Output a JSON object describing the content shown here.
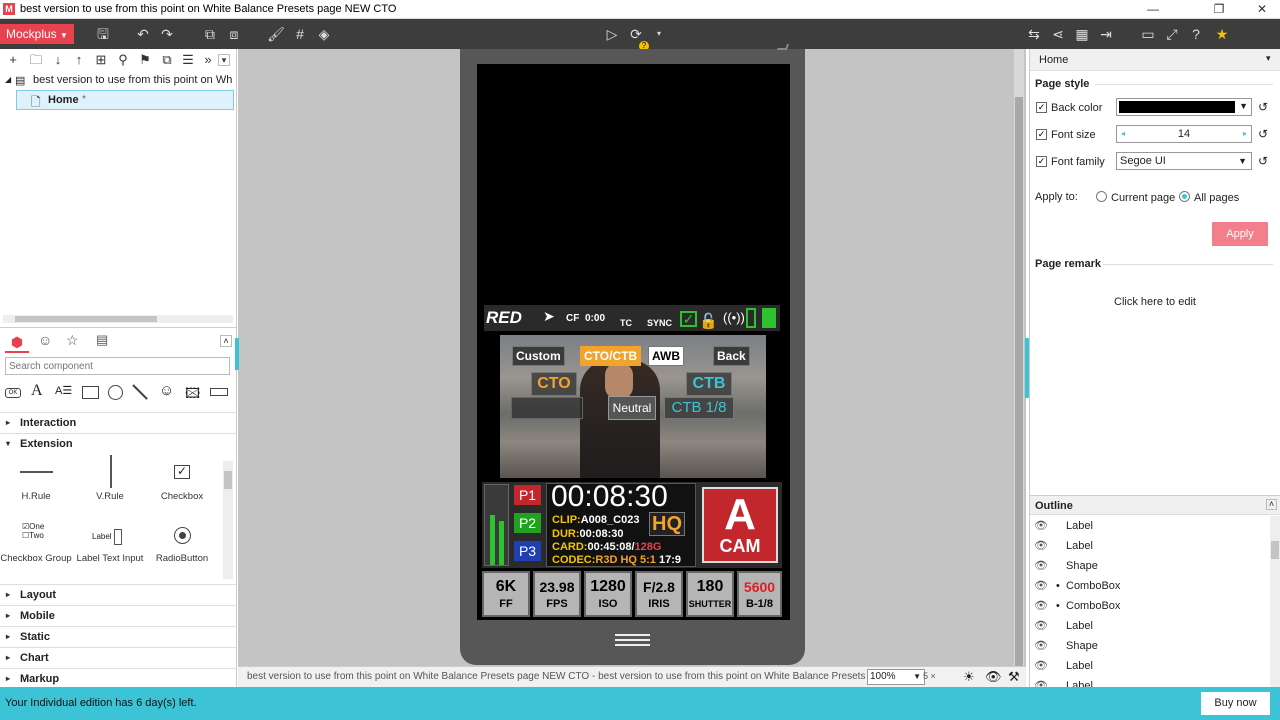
{
  "window": {
    "title": "best version to use from this point on White Balance Presets page NEW CTO"
  },
  "toolbar": {
    "brand": "Mockplus"
  },
  "tree": {
    "project": "best version to use from this point on White B",
    "page": "Home",
    "page_marker": "*"
  },
  "library": {
    "search_placeholder": "Search component",
    "categories": [
      "Interaction",
      "Extension",
      "Layout",
      "Mobile",
      "Static",
      "Chart",
      "Markup"
    ],
    "components": [
      {
        "label": "H.Rule"
      },
      {
        "label": "V.Rule"
      },
      {
        "label": "Checkbox"
      },
      {
        "label": "Checkbox Group",
        "opt1": "One",
        "opt2": "Two"
      },
      {
        "label": "Label Text Input",
        "mini": "Label"
      },
      {
        "label": "RadioButton"
      }
    ]
  },
  "camera": {
    "brand": "RED",
    "cf": "CF",
    "cf_time": "0:00",
    "tc": "TC",
    "sync": "SYNC",
    "wb_buttons": [
      "Custom",
      "CTO/CTB",
      "AWB",
      "Back"
    ],
    "cto": "CTO",
    "ctb": "CTB",
    "neutral": "Neutral",
    "ctb_frac": "CTB 1/8",
    "presets": [
      "P1",
      "P2",
      "P3"
    ],
    "timecode": "00:08:30",
    "clip_label": "CLIP:",
    "clip": "A008_C023",
    "quality": "HQ",
    "dur_label": "DUR:",
    "dur": "00:08:30",
    "card_label": "CARD:",
    "card": "00:45:08/",
    "card_size": "128G",
    "codec_label": "CODEC:",
    "codec": "R3D HQ 5:1",
    "ratio": "17:9",
    "cam_letter": "A",
    "cam_word": "CAM",
    "specs": [
      {
        "v": "6K",
        "k": "FF"
      },
      {
        "v": "23.98",
        "k": "FPS"
      },
      {
        "v": "1280",
        "k": "ISO"
      },
      {
        "v": "F/2.8",
        "k": "IRIS"
      },
      {
        "v": "180",
        "k": "SHUTTER"
      },
      {
        "v": "5600",
        "k": "B-1/8"
      }
    ]
  },
  "canvas_bar": {
    "breadcrumb": "best version to use from this point on White Balance Presets page NEW CTO - best version to use from this point on White Balance Presets page NEW CT",
    "zoom": "100%",
    "extra": "5 ×"
  },
  "right": {
    "header": "Home",
    "page_style": "Page style",
    "back_color_label": "Back color",
    "font_size_label": "Font size",
    "font_size_value": "14",
    "font_family_label": "Font family",
    "font_family_value": "Segoe UI",
    "apply_to": "Apply to:",
    "current_page": "Current page",
    "all_pages": "All pages",
    "apply_btn": "Apply",
    "page_remark": "Page remark",
    "remark_hint": "Click here to edit",
    "outline_title": "Outline",
    "outline": [
      "Label",
      "Label",
      "Shape",
      "ComboBox",
      "ComboBox",
      "Label",
      "Shape",
      "Label",
      "Label"
    ]
  },
  "status": {
    "message": "Your Individual edition has 6 day(s) left.",
    "buy": "Buy now"
  },
  "colors": {
    "brand": "#e8414f",
    "status": "#3cc4d6",
    "toolbar": "#3d3d3d",
    "apply": "#f47f8c"
  }
}
